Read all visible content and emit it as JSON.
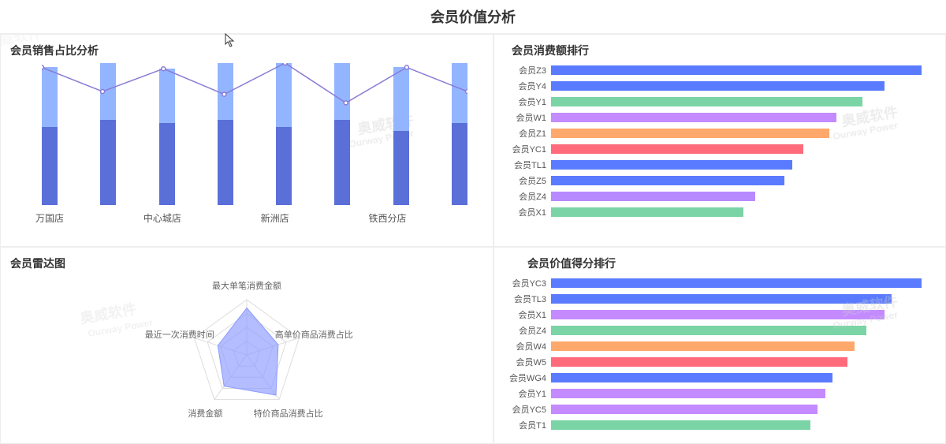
{
  "page_title": "会员价值分析",
  "watermark_cn": "奥威软件",
  "watermark_en": "Ourway Power",
  "panels": {
    "sales_ratio": {
      "title": "会员销售占比分析"
    },
    "consume_rank": {
      "title": "会员消费额排行"
    },
    "radar": {
      "title": "会员雷达图"
    },
    "value_rank": {
      "title": "会员价值得分排行"
    }
  },
  "chart_data": [
    {
      "id": "sales_ratio",
      "type": "bar+line",
      "categories": [
        "万国店",
        "",
        "中心城店",
        "",
        "新洲店",
        "",
        "铁西分店",
        ""
      ],
      "series": [
        {
          "name": "segment_a",
          "kind": "stacked-bar",
          "values": [
            42,
            40,
            38,
            40,
            45,
            40,
            45,
            42
          ],
          "color": "#93b5ff"
        },
        {
          "name": "segment_b",
          "kind": "stacked-bar",
          "values": [
            55,
            60,
            58,
            60,
            55,
            60,
            52,
            58
          ],
          "color": "#5a6fd8"
        },
        {
          "name": "trend",
          "kind": "line",
          "values": [
            97,
            80,
            96,
            78,
            100,
            72,
            97,
            80
          ],
          "color": "#8a7bd6"
        }
      ],
      "ylim": [
        0,
        100
      ]
    },
    {
      "id": "consume_rank",
      "type": "bar-horizontal",
      "categories": [
        "会员Z3",
        "会员Y4",
        "会员Y1",
        "会员W1",
        "会员Z1",
        "会员YC1",
        "会员TL1",
        "会员Z5",
        "会员Z4",
        "会员X1"
      ],
      "values": [
        100,
        90,
        84,
        77,
        75,
        68,
        65,
        63,
        55,
        52
      ],
      "colors": [
        "#5a7bff",
        "#5a7bff",
        "#7bd4a6",
        "#c48aff",
        "#ffa86b",
        "#ff6b7b",
        "#5a7bff",
        "#5a7bff",
        "#b78aff",
        "#7bd4a6"
      ]
    },
    {
      "id": "radar",
      "type": "radar",
      "axes": [
        "最大单笔消费金额",
        "高单价商品消费占比",
        "特价商品消费占比",
        "消费金额",
        "最近一次消费时间"
      ],
      "values": [
        0.85,
        0.6,
        0.9,
        0.7,
        0.55
      ],
      "fill": "#8a9aff"
    },
    {
      "id": "value_rank",
      "type": "bar-horizontal",
      "categories": [
        "会员YC3",
        "会员TL3",
        "会员X1",
        "会员Z4",
        "会员W4",
        "会员W5",
        "会员WG4",
        "会员Y1",
        "会员YC5",
        "会员T1"
      ],
      "values": [
        100,
        92,
        90,
        85,
        82,
        80,
        76,
        74,
        72,
        70
      ],
      "colors": [
        "#5a7bff",
        "#5a7bff",
        "#c48aff",
        "#7bd4a6",
        "#ffa86b",
        "#ff6b7b",
        "#5a7bff",
        "#c48aff",
        "#c48aff",
        "#7bd4a6"
      ]
    }
  ]
}
